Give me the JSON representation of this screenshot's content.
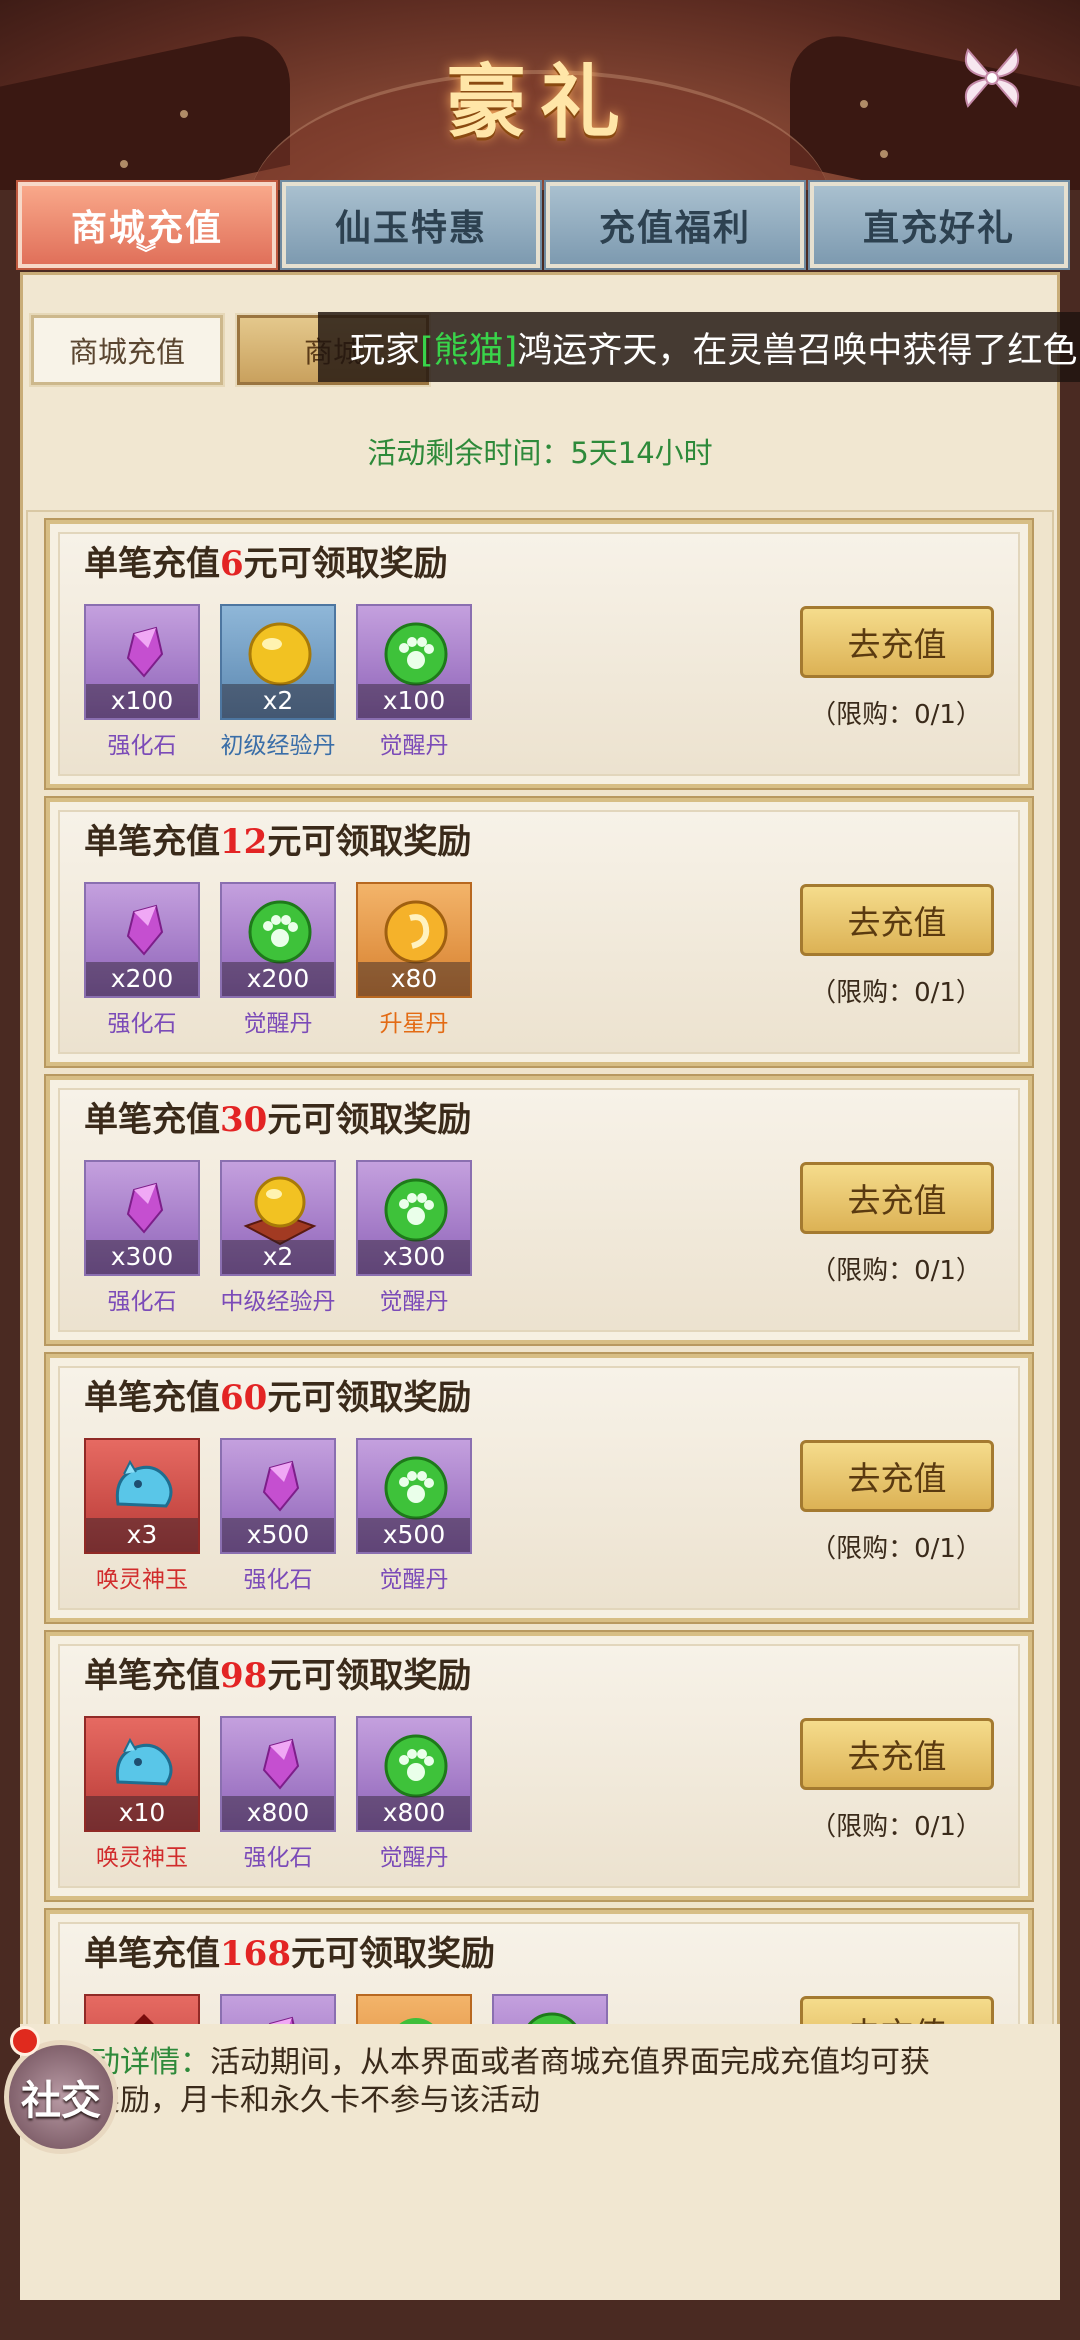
{
  "header": {
    "title": "豪礼"
  },
  "tabs": [
    {
      "label": "商城充值",
      "active": true
    },
    {
      "label": "仙玉特惠",
      "active": false
    },
    {
      "label": "充值福利",
      "active": false
    },
    {
      "label": "直充好礼",
      "active": false
    }
  ],
  "subtabs": [
    {
      "label": "商城充值",
      "active": false
    },
    {
      "label": "商城",
      "active": true
    }
  ],
  "marquee": {
    "pre": "玩家",
    "player": "[熊猫]",
    "post": "鸿运齐天，在灵兽召唤中获得了红色"
  },
  "remaining": "活动剩余时间：5天14小时",
  "cards": [
    {
      "title_pre": "单笔充值",
      "amount": "6",
      "title_post": "元可领取奖励",
      "button": "去充值",
      "limit": "（限购：0/1）",
      "items": [
        {
          "name": "强化石",
          "qty": "x100",
          "icon": "crystal-icon",
          "bg": "purple"
        },
        {
          "name": "初级经验丹",
          "qty": "x2",
          "icon": "gold-orb-icon",
          "bg": "blue"
        },
        {
          "name": "觉醒丹",
          "qty": "x100",
          "icon": "green-paw-orb-icon",
          "bg": "purple"
        }
      ]
    },
    {
      "title_pre": "单笔充值",
      "amount": "12",
      "title_post": "元可领取奖励",
      "button": "去充值",
      "limit": "（限购：0/1）",
      "items": [
        {
          "name": "强化石",
          "qty": "x200",
          "icon": "crystal-icon",
          "bg": "purple"
        },
        {
          "name": "觉醒丹",
          "qty": "x200",
          "icon": "green-paw-orb-icon",
          "bg": "purple"
        },
        {
          "name": "升星丹",
          "qty": "x80",
          "icon": "star-pill-icon",
          "bg": "orange"
        }
      ]
    },
    {
      "title_pre": "单笔充值",
      "amount": "30",
      "title_post": "元可领取奖励",
      "button": "去充值",
      "limit": "（限购：0/1）",
      "items": [
        {
          "name": "强化石",
          "qty": "x300",
          "icon": "crystal-icon",
          "bg": "purple"
        },
        {
          "name": "中级经验丹",
          "qty": "x2",
          "icon": "gold-orb-box-icon",
          "bg": "purple"
        },
        {
          "name": "觉醒丹",
          "qty": "x300",
          "icon": "green-paw-orb-icon",
          "bg": "purple"
        }
      ]
    },
    {
      "title_pre": "单笔充值",
      "amount": "60",
      "title_post": "元可领取奖励",
      "button": "去充值",
      "limit": "（限购：0/1）",
      "items": [
        {
          "name": "唤灵神玉",
          "qty": "x3",
          "icon": "jade-beast-icon",
          "bg": "red"
        },
        {
          "name": "强化石",
          "qty": "x500",
          "icon": "crystal-icon",
          "bg": "purple"
        },
        {
          "name": "觉醒丹",
          "qty": "x500",
          "icon": "green-paw-orb-icon",
          "bg": "purple"
        }
      ]
    },
    {
      "title_pre": "单笔充值",
      "amount": "98",
      "title_post": "元可领取奖励",
      "button": "去充值",
      "limit": "（限购：0/1）",
      "items": [
        {
          "name": "唤灵神玉",
          "qty": "x10",
          "icon": "jade-beast-icon",
          "bg": "red"
        },
        {
          "name": "强化石",
          "qty": "x800",
          "icon": "crystal-icon",
          "bg": "purple"
        },
        {
          "name": "觉醒丹",
          "qty": "x800",
          "icon": "green-paw-orb-icon",
          "bg": "purple"
        }
      ]
    },
    {
      "title_pre": "单笔充值",
      "amount": "168",
      "title_post": "元可领取奖励",
      "button": "去充值",
      "limit": "",
      "items": [
        {
          "name": "",
          "qty": "",
          "icon": "red-item-icon",
          "bg": "red"
        },
        {
          "name": "",
          "qty": "",
          "icon": "crystal-icon",
          "bg": "purple"
        },
        {
          "name": "",
          "qty": "",
          "icon": "orange-item-icon",
          "bg": "orange"
        },
        {
          "name": "",
          "qty": "",
          "icon": "green-paw-orb-icon",
          "bg": "purple"
        }
      ]
    }
  ],
  "detail": {
    "label": "动详情：",
    "text": "活动期间，从本界面或者商城充值界面完成充值均可获",
    "text2": "奖励，月卡和永久卡不参与该活动"
  },
  "social": {
    "label": "社交"
  }
}
